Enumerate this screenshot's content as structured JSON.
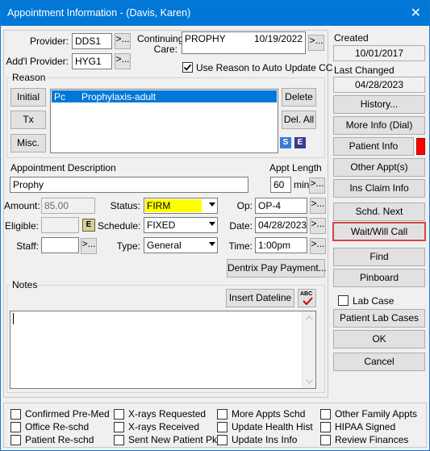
{
  "title": "Appointment Information - (Davis, Karen)",
  "close_glyph": "✕",
  "provider": {
    "label": "Provider:",
    "value": "DDS1",
    "btn": ">..."
  },
  "addl_provider": {
    "label": "Add'l Provider:",
    "value": "HYG1",
    "btn": ">..."
  },
  "continuing_care": {
    "label_1": "Continuing",
    "label_2": "Care:",
    "reason": "PROPHY",
    "date": "10/19/2022",
    "btn": ">...",
    "use_reason_label": "Use Reason to Auto Update CC",
    "use_reason_checked": true
  },
  "created": {
    "label": "Created",
    "value": "10/01/2017"
  },
  "last_changed": {
    "label": "Last Changed",
    "value": "04/28/2023"
  },
  "reason": {
    "title": "Reason",
    "initial": "Initial",
    "tx": "Tx",
    "misc": "Misc.",
    "delete": "Delete",
    "del_all": "Del. All",
    "items": [
      {
        "code": "Pc",
        "desc": "Prophylaxis-adult"
      }
    ],
    "s_icon": "S",
    "e_icon": "E"
  },
  "appt_desc": {
    "label": "Appointment Description",
    "value": "Prophy"
  },
  "appt_length": {
    "label": "Appt Length",
    "value": "60",
    "unit": "min",
    "btn": ">..."
  },
  "amount": {
    "label": "Amount:",
    "value": "85.00"
  },
  "eligible": {
    "label": "Eligible:",
    "value": "",
    "icon": "E"
  },
  "staff": {
    "label": "Staff:",
    "value": "",
    "btn": ">..."
  },
  "status": {
    "label": "Status:",
    "value": "FIRM",
    "color": "#ffff00"
  },
  "schedule": {
    "label": "Schedule:",
    "value": "FIXED"
  },
  "type": {
    "label": "Type:",
    "value": "General"
  },
  "op": {
    "label": "Op:",
    "value": "OP-4",
    "btn": ">..."
  },
  "date": {
    "label": "Date:",
    "value": "04/28/2023",
    "btn": ">..."
  },
  "time": {
    "label": "Time:",
    "value": "1:00pm",
    "btn": ">..."
  },
  "dentrix_pay": "Dentrix Pay Payment...",
  "notes": {
    "title": "Notes",
    "insert_dateline": "Insert Dateline",
    "spell_icon": "ABC",
    "value": ""
  },
  "right_buttons": {
    "history": "History...",
    "more_info": "More Info (Dial)",
    "patient_info": "Patient Info",
    "patient_info_flag_color": "#ff0000",
    "other_appts": "Other Appt(s)",
    "ins_claim": "Ins Claim Info",
    "schd_next": "Schd. Next",
    "wait_will_call": "Wait/Will Call",
    "find": "Find",
    "pinboard": "Pinboard",
    "lab_case": "Lab Case",
    "patient_lab_cases": "Patient Lab Cases",
    "ok": "OK",
    "cancel": "Cancel"
  },
  "checkboxes": [
    [
      "Confirmed Pre-Med",
      "X-rays Requested",
      "More Appts Schd",
      "Other Family Appts"
    ],
    [
      "Office Re-schd",
      "X-rays Received",
      "Update Health Hist",
      "HIPAA Signed"
    ],
    [
      "Patient Re-schd",
      "Sent New Patient Pkg",
      "Update Ins Info",
      "Review Finances"
    ]
  ]
}
